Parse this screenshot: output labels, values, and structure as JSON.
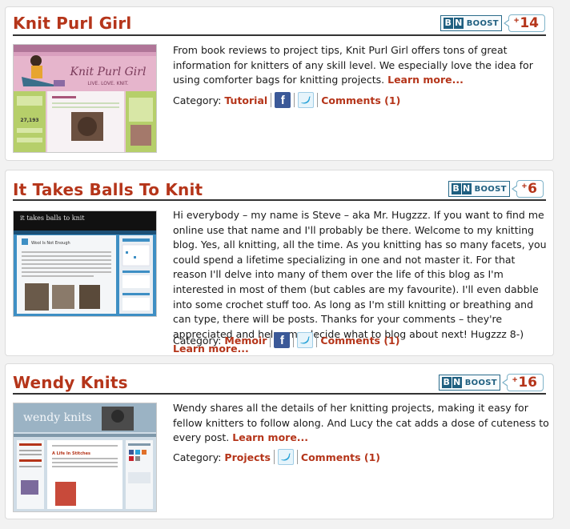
{
  "boost": {
    "bn_b": "B",
    "bn_n": "N",
    "label": "BOOST",
    "plus": "+"
  },
  "category_label": "Category:",
  "icons": {
    "facebook": "facebook-icon",
    "twitter": "twitter-icon"
  },
  "colors": {
    "accent": "#b5351a",
    "boost_blue": "#1f5f80"
  },
  "posts": [
    {
      "title": "Knit Purl Girl",
      "count": "14",
      "description": "From book reviews to project tips, Knit Purl Girl offers tons of great information for knitters of any skill level. We especially love the idea for using comforter bags for knitting projects.",
      "learn_more": "Learn more...",
      "category": "Tutorial",
      "comments": "Comments (1)",
      "thumb": {
        "banner": "Knit Purl Girl",
        "tagline": "LIVE. LOVE. KNIT.",
        "stat": "27,193"
      }
    },
    {
      "title": "It Takes Balls To Knit",
      "count": "6",
      "description": "Hi everybody – my name is Steve – aka Mr. Hugzzz. If you want to find me online use that name and I'll probably be there. Welcome to my knitting blog. Yes, all knitting, all the time. As you knitting has so many facets, you could spend a lifetime specializing in one and not master it. For that reason I'll delve into many of them over the life of this blog as I'm interested in most of them (but cables are my favourite). I'll even dabble into some crochet stuff too. As long as I'm still knitting or breathing and can type, there will be posts. Thanks for your comments – they're appreciated and helps me decide what to blog about next! Hugzzz 8-)",
      "learn_more": "Learn more...",
      "category": "Memoir",
      "comments": "Comments (1)",
      "thumb": {
        "banner": "it takes balls to knit",
        "post_title": "Wool Is Not Enough"
      }
    },
    {
      "title": "Wendy Knits",
      "count": "16",
      "description": "Wendy shares all the details of her knitting projects, making it easy for fellow knitters to follow along. And Lucy the cat adds a dose of cuteness to every post.",
      "learn_more": "Learn more...",
      "category": "Projects",
      "comments": "Comments (1)",
      "thumb": {
        "banner": "wendy knits",
        "post_title": "A Life In Stitches"
      }
    }
  ]
}
